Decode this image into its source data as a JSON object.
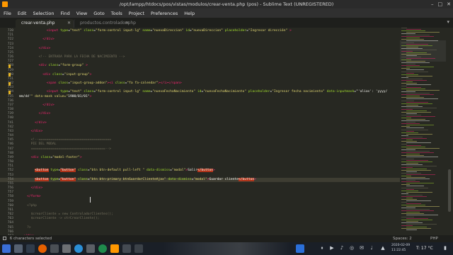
{
  "window": {
    "title": "/opt/lampp/htdocs/pos/vistas/modulos/crear-venta.php (pos) - Sublime Text (UNREGISTERED)",
    "controls": [
      "–",
      "□",
      "✕"
    ]
  },
  "menu": [
    "File",
    "Edit",
    "Selection",
    "Find",
    "View",
    "Goto",
    "Tools",
    "Project",
    "Preferences",
    "Help"
  ],
  "tabs": [
    {
      "label": "crear-venta.php",
      "active": true
    },
    {
      "label": "productos.controlador.php",
      "active": false
    }
  ],
  "editor": {
    "lines": [
      {
        "n": "720",
        "code": "              <input type=\"text\" class=\"form-control input-lg\" name=\"nuevaDireccion\" id=\"nuevaDireccion\" placeholder=\"Ingresar dirección\" >"
      },
      {
        "n": "721",
        "code": ""
      },
      {
        "n": "722",
        "code": "            </div>"
      },
      {
        "n": "723",
        "code": ""
      },
      {
        "n": "724",
        "code": "          </div>"
      },
      {
        "n": "725",
        "code": ""
      },
      {
        "n": "726",
        "code": "          <!-- ENTRADA PARA LA FECHA DE NACIMIENTO -->"
      },
      {
        "n": "727",
        "code": ""
      },
      {
        "n": "728",
        "code": "          <div class=\"form-group\" >"
      },
      {
        "n": "729",
        "code": ""
      },
      {
        "n": "730",
        "code": "            <div class=\"input-group\">"
      },
      {
        "n": "731",
        "code": ""
      },
      {
        "n": "732",
        "code": "              <span class=\"input-group-addon\"><i class=\"fa fa-calendar\"></i></span>"
      },
      {
        "n": "733",
        "code": ""
      },
      {
        "n": "734",
        "code": "              <input type=\"text\" class=\"form-control input-lg\" name=\"nuevaFechaNacimiento\" id=\"nuevaFechaNacimiento\" placeholder=\"Ingresar fecha nacimiento\" data-inputmask=\"'alias': 'yyyy/"
      },
      {
        "n": "735",
        "code": "mm/dd'\" data-mask value=\"1900/01/01\">"
      },
      {
        "n": "736",
        "code": ""
      },
      {
        "n": "737",
        "code": "            </div>"
      },
      {
        "n": "738",
        "code": ""
      },
      {
        "n": "739",
        "code": "          </div>"
      },
      {
        "n": "740",
        "code": ""
      },
      {
        "n": "741",
        "code": "        </div>"
      },
      {
        "n": "742",
        "code": ""
      },
      {
        "n": "743",
        "code": "      </div>"
      },
      {
        "n": "744",
        "code": ""
      },
      {
        "n": "745",
        "code": "      <!--====================================="
      },
      {
        "n": "746",
        "code": "      PIE DEL MODAL"
      },
      {
        "n": "747",
        "code": "      ======================================-->"
      },
      {
        "n": "748",
        "code": ""
      },
      {
        "n": "749",
        "code": "      <div class=\"modal-footer\">"
      },
      {
        "n": "750",
        "code": ""
      },
      {
        "n": "751",
        "code": ""
      },
      {
        "n": "752",
        "code": "        <button type=\"button\" class=\"btn btn-default pull-left \" data-dismiss=\"modal\">Salir</button>"
      },
      {
        "n": "753",
        "code": ""
      },
      {
        "n": "754",
        "code": "        <button type=\"button\" class=\"btn btn-primary btnGuardarClienteAjax\" data-dismiss=\"modal\">Guardar cliente</button>"
      },
      {
        "n": "755",
        "code": ""
      },
      {
        "n": "756",
        "code": "      </div>"
      },
      {
        "n": "757",
        "code": ""
      },
      {
        "n": "758",
        "code": "    </form>"
      },
      {
        "n": "759",
        "code": ""
      },
      {
        "n": "760",
        "code": "    <?php"
      },
      {
        "n": "761",
        "code": ""
      },
      {
        "n": "762",
        "code": "      $crearCliente = new ControladorClientes();"
      },
      {
        "n": "763",
        "code": "      $crearCliente -> ctrCrearCliente();"
      },
      {
        "n": "764",
        "code": ""
      },
      {
        "n": "765",
        "code": "    ?>"
      },
      {
        "n": "766",
        "code": ""
      },
      {
        "n": "767",
        "code": "  </div>"
      }
    ]
  },
  "status": {
    "left": "6 characters selected",
    "spaces": "Spaces: 2",
    "syntax": "PHP"
  },
  "taskbar": {
    "date": "2020-02-09",
    "time": "11:22:45",
    "temperature": "T: 17 °C"
  },
  "colors": {
    "background": "#272822",
    "tag": "#f92672",
    "attribute": "#a6e22e",
    "string": "#e6db74",
    "comment": "#75715e",
    "selection_highlight": "#b0341a"
  }
}
